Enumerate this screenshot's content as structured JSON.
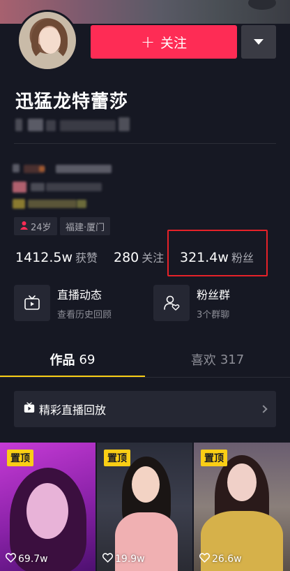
{
  "profile": {
    "name": "迅猛龙特蕾莎",
    "follow_label": "关注",
    "follow_plus": "+",
    "tags": {
      "age": "24岁",
      "location": "福建·厦门"
    }
  },
  "stats": [
    {
      "value": "1412.5w",
      "label": "获赞"
    },
    {
      "value": "280",
      "label": "关注"
    },
    {
      "value": "321.4w",
      "label": "粉丝"
    }
  ],
  "features": [
    {
      "title": "直播动态",
      "subtitle": "查看历史回顾",
      "icon": "tv-icon"
    },
    {
      "title": "粉丝群",
      "subtitle": "3个群聊",
      "icon": "fan-group-icon"
    }
  ],
  "tabs": [
    {
      "label": "作品",
      "count": "69",
      "active": true
    },
    {
      "label": "喜欢",
      "count": "317",
      "active": false
    }
  ],
  "replay": {
    "label": "精彩直播回放"
  },
  "videos": [
    {
      "pin": "置顶",
      "likes": "69.7w"
    },
    {
      "pin": "置顶",
      "likes": "19.9w"
    },
    {
      "pin": "置顶",
      "likes": "26.6w"
    }
  ],
  "colors": {
    "background": "#161823",
    "accent": "#fe2c55",
    "tab_underline": "#face15",
    "highlight_box": "#e62229"
  }
}
